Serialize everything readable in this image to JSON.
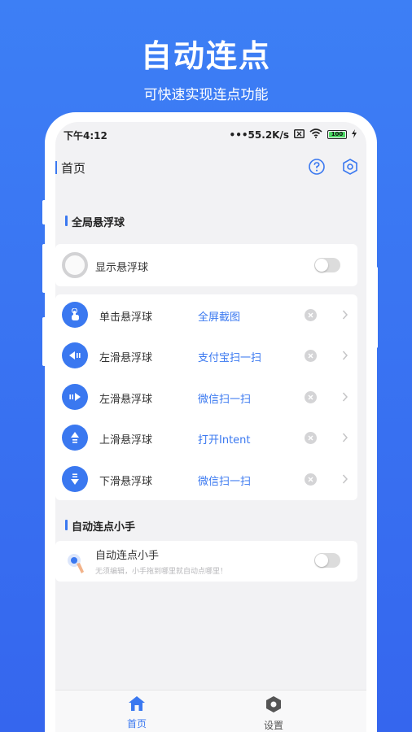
{
  "promo": {
    "title": "自动连点",
    "subtitle": "可快速实现连点功能"
  },
  "status_bar": {
    "time": "下午4:12",
    "network_speed": "•••55.2K/s",
    "battery": "100"
  },
  "app_bar": {
    "title": "首页"
  },
  "global_float": {
    "section_title": "全局悬浮球",
    "show_float": {
      "label": "显示悬浮球",
      "enabled": false
    },
    "gestures": [
      {
        "label": "单击悬浮球",
        "action": "全屏截图",
        "icon": "tap-hand-icon"
      },
      {
        "label": "左滑悬浮球",
        "action": "支付宝扫一扫",
        "icon": "swipe-left-icon"
      },
      {
        "label": "左滑悬浮球",
        "action": "微信扫一扫",
        "icon": "swipe-right-icon"
      },
      {
        "label": "上滑悬浮球",
        "action": "打开Intent",
        "icon": "swipe-up-icon"
      },
      {
        "label": "下滑悬浮球",
        "action": "微信扫一扫",
        "icon": "swipe-down-icon"
      }
    ]
  },
  "auto_clicker": {
    "section_title": "自动连点小手",
    "item": {
      "label": "自动连点小手",
      "hint": "无须编辑，小手拖到哪里就自动点哪里！",
      "enabled": false
    }
  },
  "bottom_nav": [
    {
      "label": "首页",
      "icon": "home-icon",
      "active": true
    },
    {
      "label": "设置",
      "icon": "settings-icon",
      "active": false
    }
  ],
  "colors": {
    "accent": "#3a78f0",
    "background": "#3566ee",
    "screen_bg": "#f2f2f4"
  }
}
